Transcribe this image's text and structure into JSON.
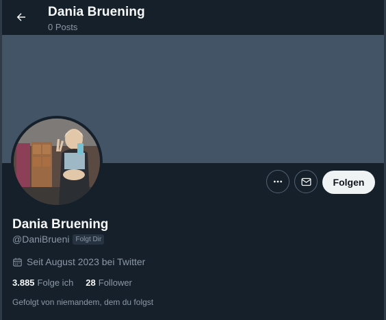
{
  "header": {
    "name": "Dania Bruening",
    "posts": "0 Posts"
  },
  "banner": {
    "color": "#425466"
  },
  "actions": {
    "more_icon": "more-horizontal-icon",
    "message_icon": "envelope-icon",
    "follow_label": "Folgen"
  },
  "profile": {
    "display_name": "Dania Bruening",
    "handle": "@DaniBrueni",
    "follows_you": "Folgt Dir",
    "joined": "Seit August 2023 bei Twitter",
    "following_count": "3.885",
    "following_label": "Folge ich",
    "followers_count": "28",
    "followers_label": "Follower",
    "followed_by": "Gefolgt von niemandem, dem du folgst"
  },
  "colors": {
    "background": "#15202b",
    "text_primary": "#f7f9f9",
    "text_secondary": "#8b98a5",
    "button_bg": "#eff3f4"
  }
}
